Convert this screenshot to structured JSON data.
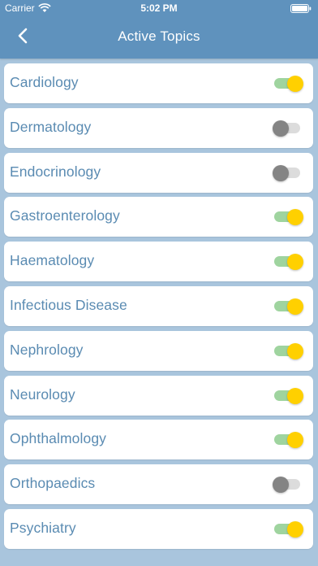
{
  "status_bar": {
    "carrier": "Carrier",
    "time": "5:02 PM",
    "wifi_icon": "wifi-icon",
    "battery_icon": "battery-icon"
  },
  "nav": {
    "title": "Active Topics",
    "back_icon": "chevron-left-icon"
  },
  "colors": {
    "header_bg": "#5f92bd",
    "page_bg": "#a9c5dd",
    "label_text": "#5a8bb2",
    "toggle_on_track": "#9fd49f",
    "toggle_on_knob": "#ffd000",
    "toggle_off_track": "#dcdcdc",
    "toggle_off_knob": "#848484"
  },
  "topics": [
    {
      "label": "Cardiology",
      "active": true
    },
    {
      "label": "Dermatology",
      "active": false
    },
    {
      "label": "Endocrinology",
      "active": false
    },
    {
      "label": "Gastroenterology",
      "active": true
    },
    {
      "label": "Haematology",
      "active": true
    },
    {
      "label": "Infectious Disease",
      "active": true
    },
    {
      "label": "Nephrology",
      "active": true
    },
    {
      "label": "Neurology",
      "active": true
    },
    {
      "label": "Ophthalmology",
      "active": true
    },
    {
      "label": "Orthopaedics",
      "active": false
    },
    {
      "label": "Psychiatry",
      "active": true
    }
  ]
}
